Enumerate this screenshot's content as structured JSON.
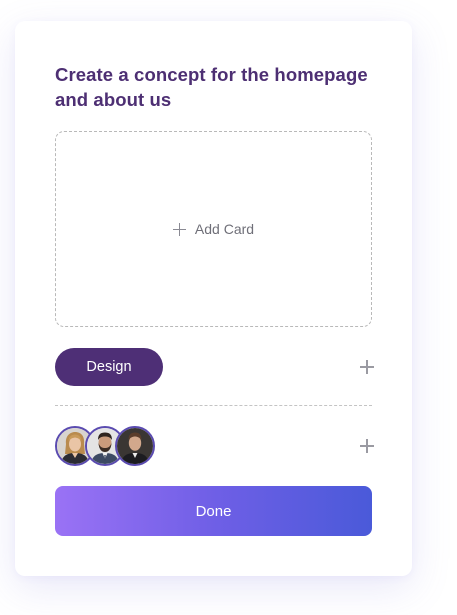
{
  "task": {
    "title": "Create a concept for the homepage and about us"
  },
  "cards": {
    "add_label": "Add Card"
  },
  "tags": [
    {
      "label": "Design"
    }
  ],
  "members": [
    {
      "avatar_icon": "woman-portrait-icon"
    },
    {
      "avatar_icon": "bearded-man-portrait-icon"
    },
    {
      "avatar_icon": "man-portrait-icon"
    }
  ],
  "actions": {
    "done_label": "Done"
  },
  "colors": {
    "title": "#4d2f73",
    "tag_background": "#4e2f76",
    "done_gradient_start": "#9a72f5",
    "done_gradient_end": "#4a5ad9",
    "avatar_ring": "#5a4bb0"
  }
}
